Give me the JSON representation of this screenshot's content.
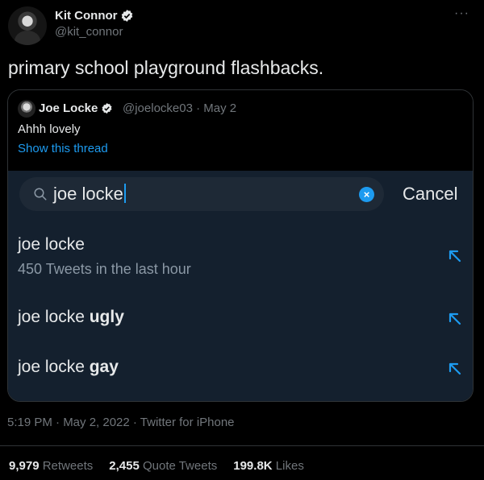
{
  "tweet": {
    "author_name": "Kit Connor",
    "author_handle": "@kit_connor",
    "more_label": "···",
    "text": "primary school playground flashbacks.",
    "timestamp": "5:19 PM · May 2, 2022 · Twitter for iPhone"
  },
  "quote": {
    "name": "Joe Locke",
    "meta": "@joelocke03 · May 2",
    "text": "Ahhh lovely",
    "thread_link": "Show this thread"
  },
  "screenshot": {
    "search_value": "joe locke",
    "clear_label": "×",
    "cancel_label": "Cancel",
    "suggestions": [
      {
        "title": "joe locke",
        "bold": "",
        "sub": "450 Tweets in the last hour"
      },
      {
        "title": "joe locke ",
        "bold": "ugly",
        "sub": ""
      },
      {
        "title": "joe locke ",
        "bold": "gay",
        "sub": ""
      }
    ]
  },
  "stats": {
    "retweets_count": "9,979",
    "retweets_label": "Retweets",
    "quotes_count": "2,455",
    "quotes_label": "Quote Tweets",
    "likes_count": "199.8K",
    "likes_label": "Likes"
  },
  "colors": {
    "accent": "#1d9bf0",
    "muted": "#71767b",
    "search_bg": "#14202e"
  }
}
